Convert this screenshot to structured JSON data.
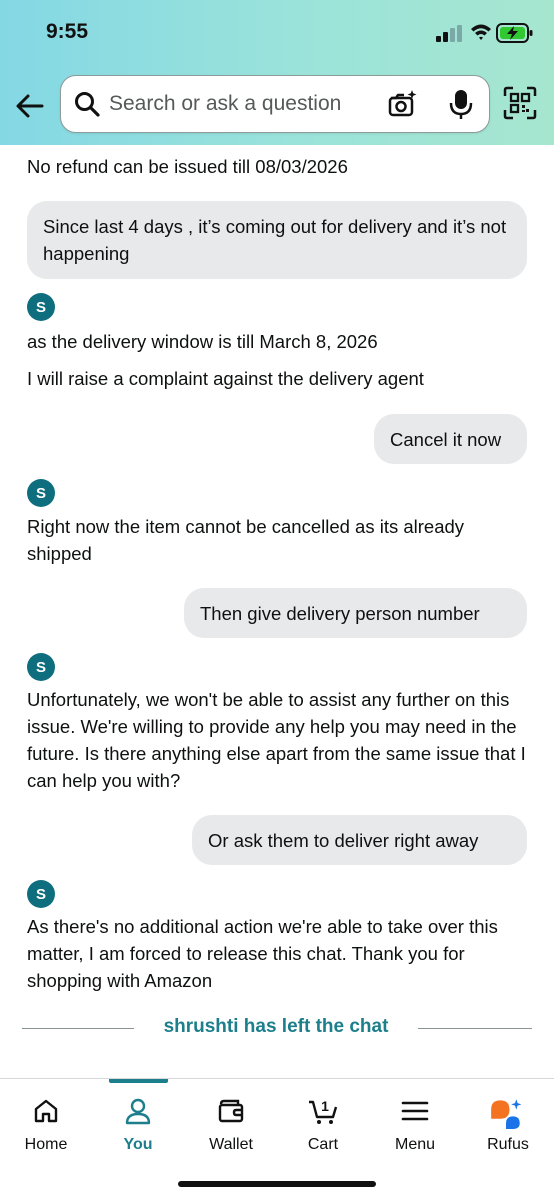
{
  "status_bar": {
    "time": "9:55"
  },
  "search": {
    "placeholder": "Search or ask a question"
  },
  "chat": {
    "messages": [
      {
        "from": "agent",
        "text": "No refund can be issued till 08/03/2026"
      },
      {
        "from": "user",
        "text": "Since last 4 days , it’s coming out for delivery and it’s not happening"
      },
      {
        "from": "agent",
        "avatar": "S",
        "text": "as the delivery window is till March 8, 2026"
      },
      {
        "from": "agent",
        "text": "I will raise a complaint against the delivery agent"
      },
      {
        "from": "user",
        "text": "Cancel it now"
      },
      {
        "from": "agent",
        "avatar": "S",
        "text": "Right now the item cannot be cancelled as its already shipped"
      },
      {
        "from": "user",
        "text": "Then give delivery person number"
      },
      {
        "from": "agent",
        "avatar": "S",
        "text": "Unfortunately, we won't be able to assist any further on this issue. We're willing to provide any help you may need in the future. Is there anything else apart from the same issue that I can help you with?"
      },
      {
        "from": "user",
        "text": "Or ask them to deliver right away"
      },
      {
        "from": "agent",
        "avatar": "S",
        "text": "As there's no additional action we're able to take over this matter, I am forced to release this chat. Thank you for shopping with Amazon"
      }
    ],
    "left_notice": "shrushti has left the chat"
  },
  "bottom_nav": {
    "items": [
      {
        "label": "Home",
        "icon": "home-icon"
      },
      {
        "label": "You",
        "icon": "person-icon",
        "active": true
      },
      {
        "label": "Wallet",
        "icon": "wallet-icon"
      },
      {
        "label": "Cart",
        "icon": "cart-icon",
        "badge": "1"
      },
      {
        "label": "Menu",
        "icon": "menu-icon"
      },
      {
        "label": "Rufus",
        "icon": "rufus-icon"
      }
    ]
  },
  "colors": {
    "accent": "#1d7f8c",
    "avatar": "#0f6e7e",
    "user_bubble": "#e8e9eb",
    "rufus_orange": "#f37321",
    "rufus_blue": "#1a73e8"
  }
}
